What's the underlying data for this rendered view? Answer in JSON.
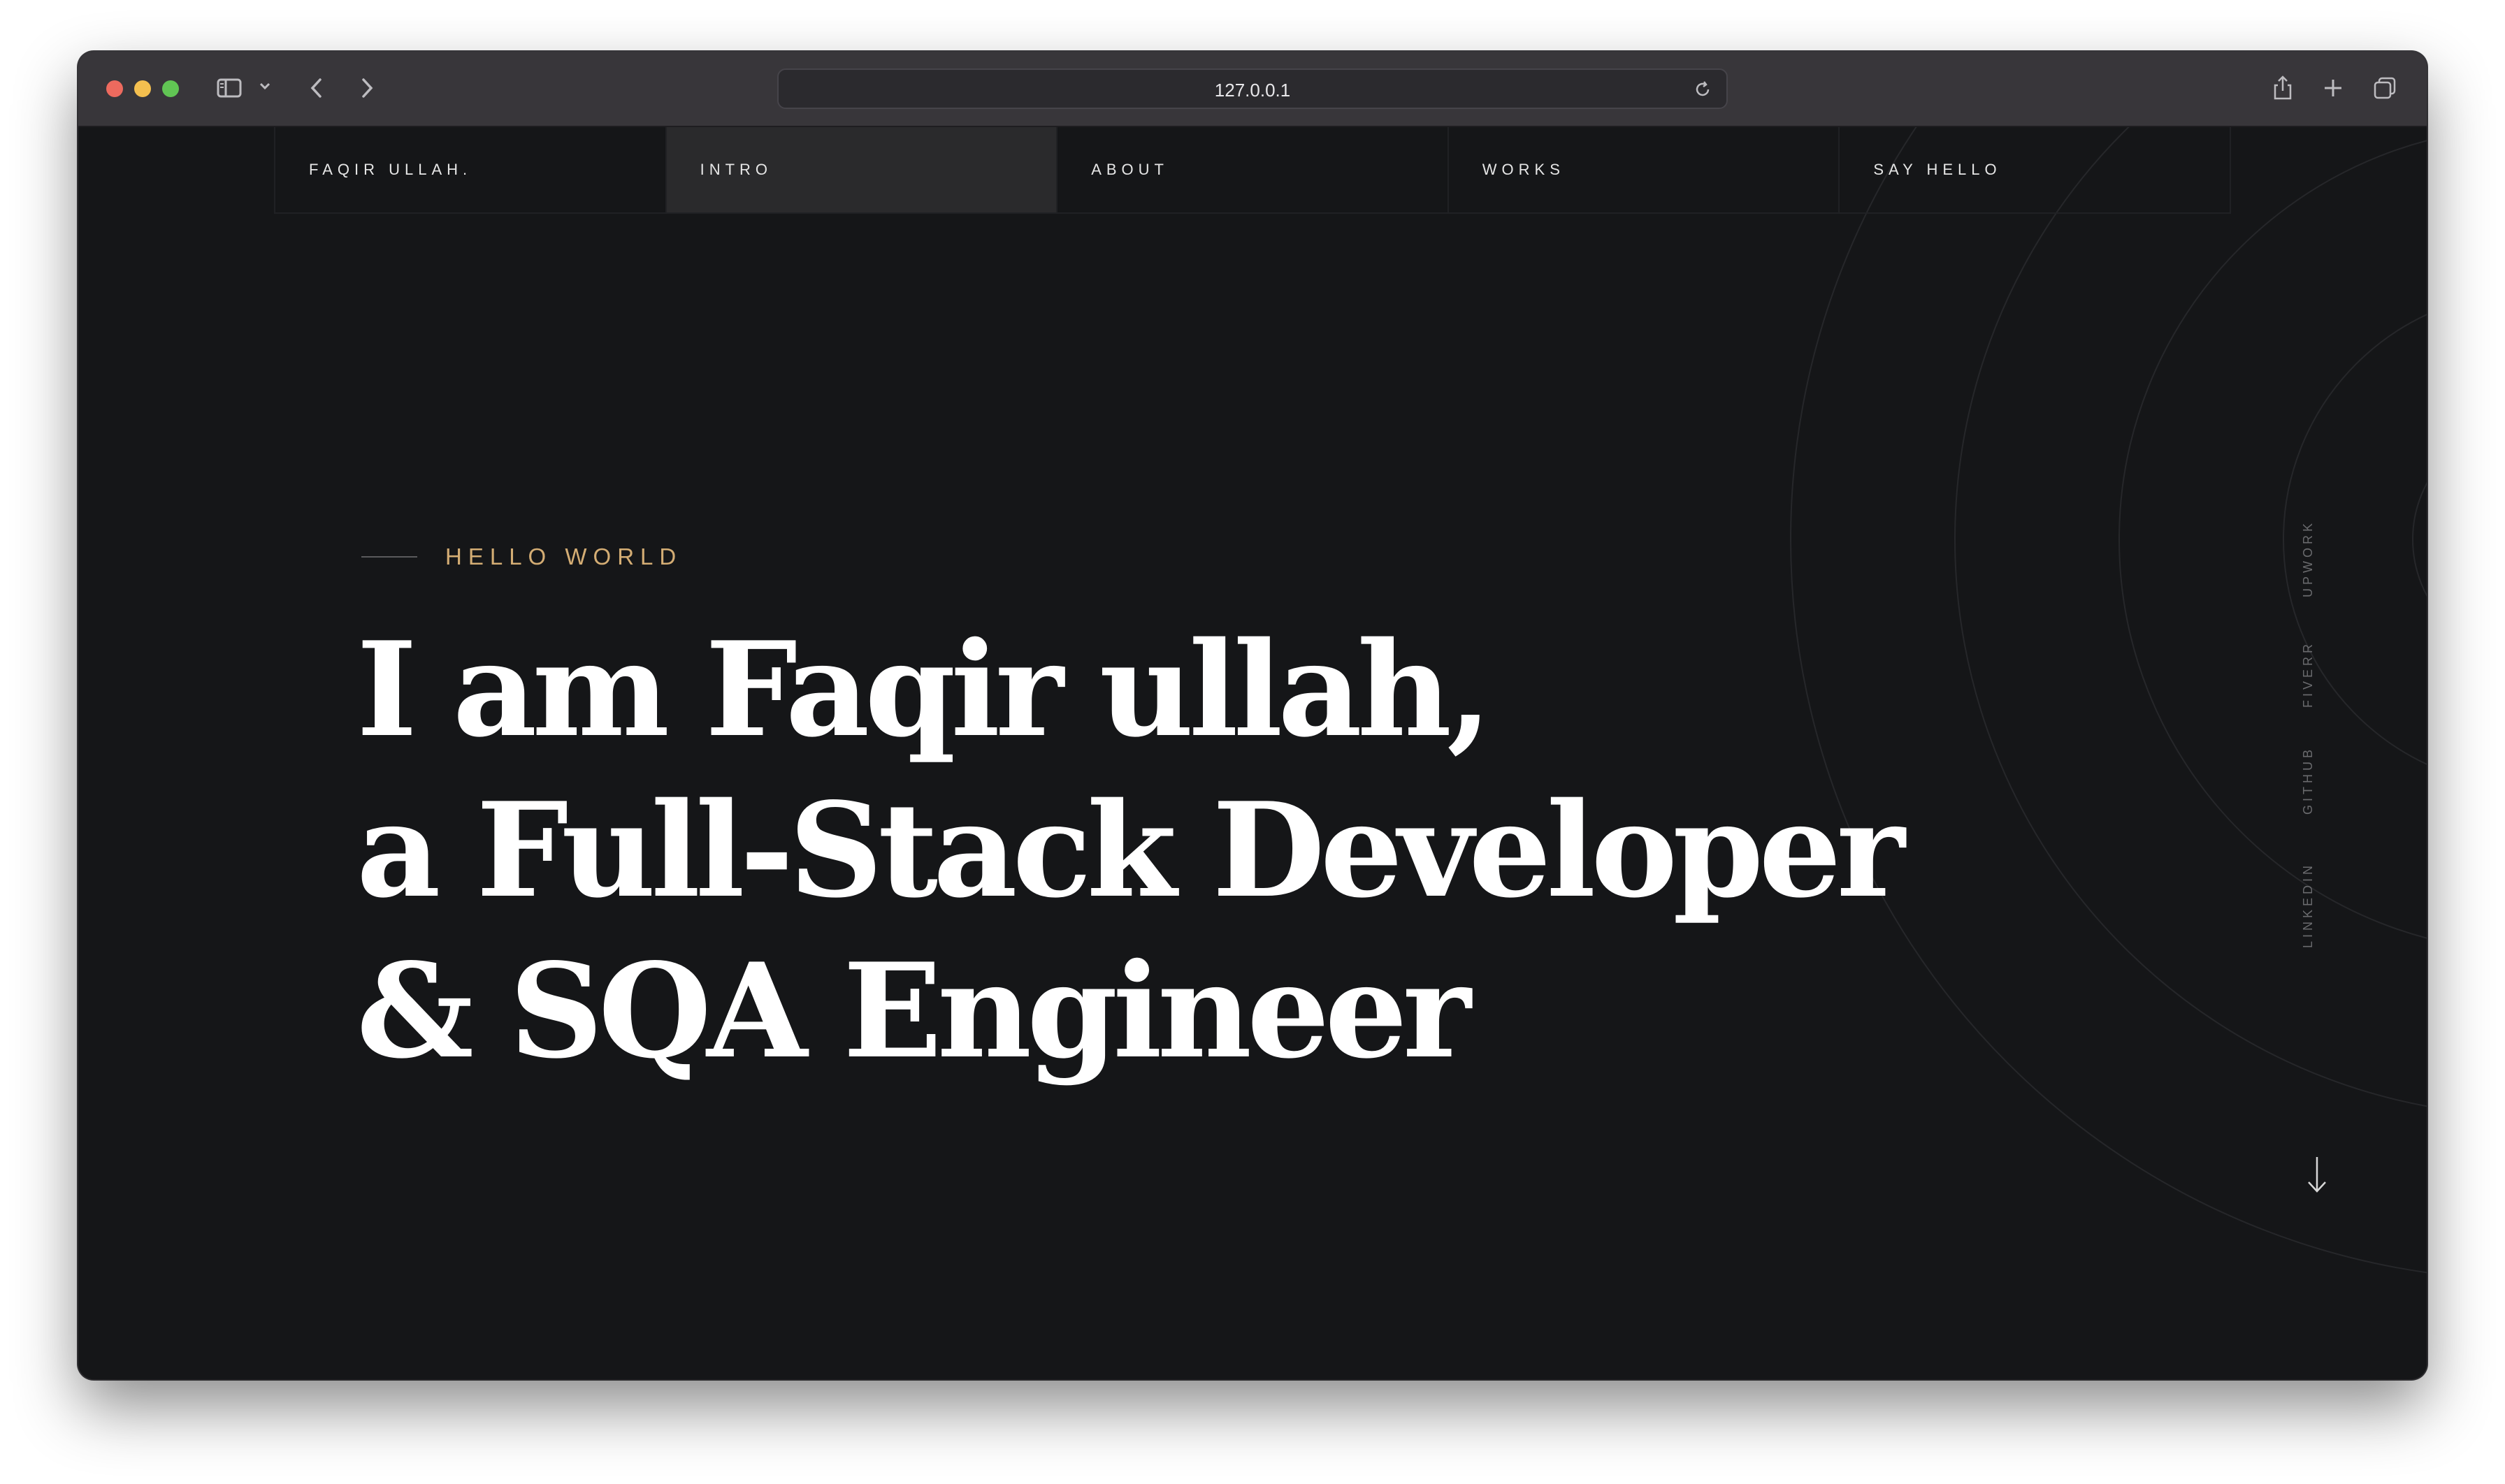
{
  "browser": {
    "url": "127.0.0.1"
  },
  "nav": {
    "brand": "FAQIR ULLAH.",
    "items": [
      "INTRO",
      "ABOUT",
      "WORKS",
      "SAY HELLO"
    ],
    "active": "INTRO"
  },
  "hero": {
    "eyebrow": "HELLO WORLD",
    "lines": [
      "I am Faqir ullah,",
      "a Full-Stack Developer",
      "& SQA Engineer"
    ]
  },
  "socials": [
    "UPWORK",
    "FIVERR",
    "GITHUB",
    "LINKEDIN"
  ],
  "colors": {
    "background": "#151618",
    "accent": "#d4ad74",
    "text": "#ffffff"
  },
  "icons": {
    "sidebar": "sidebar-toggle-icon",
    "back": "chevron-left-icon",
    "forward": "chevron-right-icon",
    "reload": "reload-icon",
    "share": "share-icon",
    "new_tab": "plus-icon",
    "tabs": "tab-overview-icon",
    "scroll": "arrow-down-icon"
  }
}
